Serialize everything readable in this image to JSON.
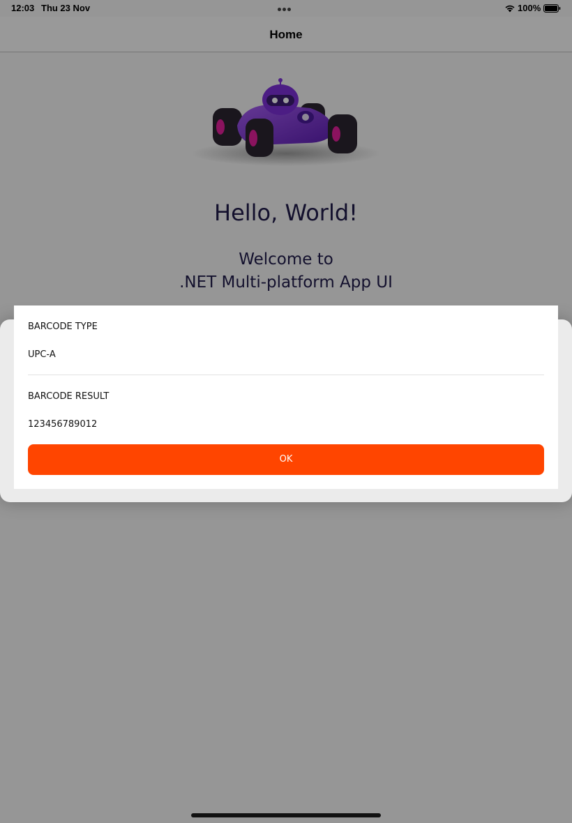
{
  "status_bar": {
    "time": "12:03",
    "date": "Thu 23 Nov",
    "battery_percent": "100%"
  },
  "nav": {
    "title": "Home"
  },
  "main": {
    "greeting": "Hello, World!",
    "welcome_line1": "Welcome to",
    "welcome_line2": ".NET Multi-platform App UI",
    "hero_icon": "race-car-robot-illustration"
  },
  "popup": {
    "barcode_type_label": "BARCODE TYPE",
    "barcode_type_value": "UPC-A",
    "barcode_result_label": "BARCODE RESULT",
    "barcode_result_value": "123456789012",
    "ok_label": "OK"
  },
  "colors": {
    "accent": "#ff4500",
    "heading_text": "#1f1b4a",
    "car_body": "#7b2fd6",
    "wheel_hub": "#e0209a"
  }
}
